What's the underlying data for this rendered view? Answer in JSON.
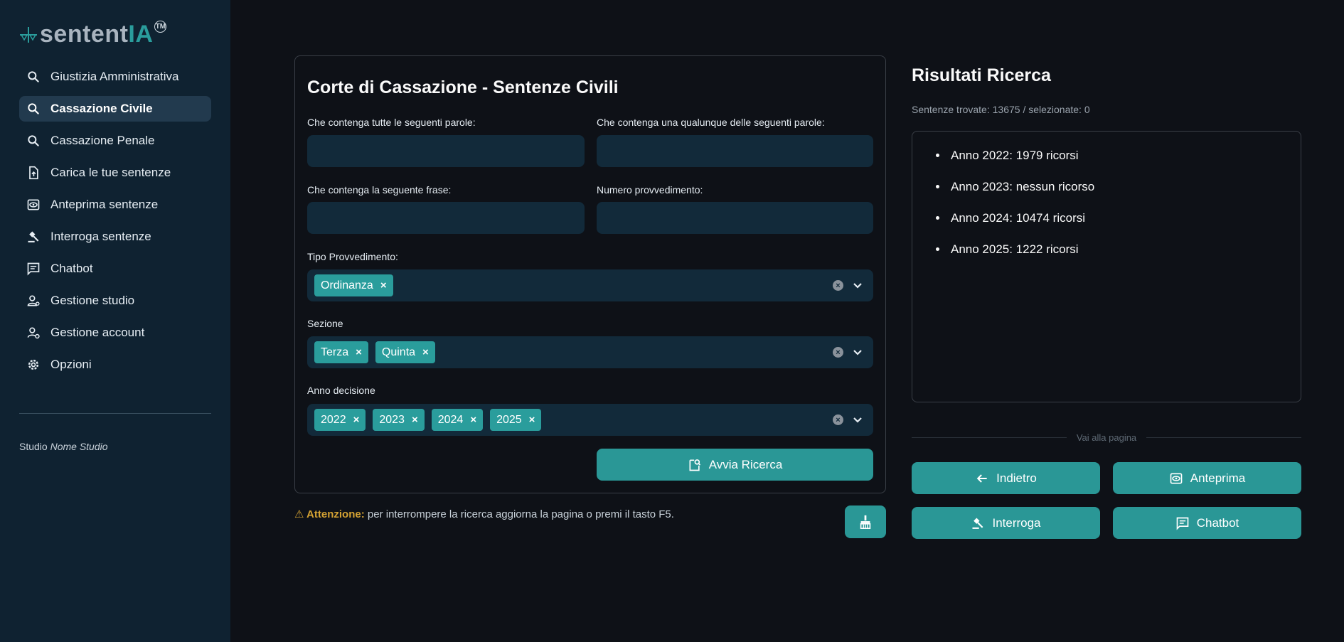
{
  "app": {
    "logo_text_main": "sentent",
    "logo_text_accent": "IA",
    "logo_tm": "TM"
  },
  "sidebar": {
    "items": [
      {
        "label": "Giustizia Amministrativa",
        "icon": "search-icon",
        "active": false
      },
      {
        "label": "Cassazione Civile",
        "icon": "search-icon",
        "active": true
      },
      {
        "label": "Cassazione Penale",
        "icon": "search-icon",
        "active": false
      },
      {
        "label": "Carica le tue sentenze",
        "icon": "upload-file-icon",
        "active": false
      },
      {
        "label": "Anteprima sentenze",
        "icon": "preview-icon",
        "active": false
      },
      {
        "label": "Interroga sentenze",
        "icon": "gavel-icon",
        "active": false
      },
      {
        "label": "Chatbot",
        "icon": "chat-icon",
        "active": false
      },
      {
        "label": "Gestione studio",
        "icon": "manage-users-icon",
        "active": false
      },
      {
        "label": "Gestione account",
        "icon": "manage-account-icon",
        "active": false
      },
      {
        "label": "Opzioni",
        "icon": "gear-icon",
        "active": false
      }
    ],
    "studio_prefix": "Studio",
    "studio_name": "Nome Studio"
  },
  "form": {
    "title": "Corte di Cassazione - Sentenze Civili",
    "all_words_label": "Che contenga tutte le seguenti parole:",
    "all_words_value": "",
    "any_words_label": "Che contenga una qualunque delle seguenti parole:",
    "any_words_value": "",
    "phrase_label": "Che contenga la seguente frase:",
    "phrase_value": "",
    "number_label": "Numero provvedimento:",
    "number_value": "",
    "tipo_label": "Tipo Provvedimento:",
    "tipo_chips": [
      "Ordinanza"
    ],
    "sezione_label": "Sezione",
    "sezione_chips": [
      "Terza",
      "Quinta"
    ],
    "anno_label": "Anno decisione",
    "anno_chips": [
      "2022",
      "2023",
      "2024",
      "2025"
    ],
    "chip_remove": "×",
    "clear_glyph": "×",
    "search_button": "Avvia Ricerca"
  },
  "warning": {
    "label": "⚠ Attenzione:",
    "text": " per interrompere la ricerca aggiorna la pagina o premi il tasto F5."
  },
  "results": {
    "title": "Risultati Ricerca",
    "count_text": "Sentenze trovate: 13675 / selezionate: 0",
    "items": [
      "Anno 2022: 1979 ricorsi",
      "Anno 2023: nessun ricorso",
      "Anno 2024: 10474 ricorsi",
      "Anno 2025: 1222 ricorsi"
    ],
    "pager_label": "Vai alla pagina",
    "back_button": "Indietro",
    "preview_button": "Anteprima",
    "query_button": "Interroga",
    "chatbot_button": "Chatbot"
  },
  "colors": {
    "accent": "#2a9796",
    "sidebar_bg": "#0f2231",
    "page_bg": "#0e1117",
    "input_bg": "#122a3a",
    "warning": "#d4a233"
  }
}
